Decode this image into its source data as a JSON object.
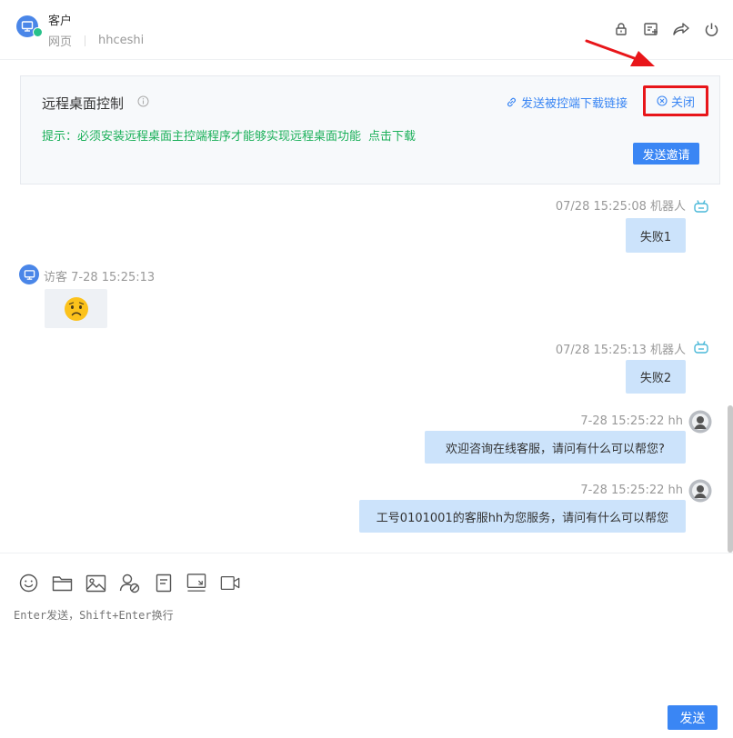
{
  "header": {
    "title": "客户",
    "channel": "网页",
    "account": "hhceshi",
    "icons": [
      "lock-icon",
      "note-add-icon",
      "share-icon",
      "power-icon"
    ]
  },
  "remote": {
    "title": "远程桌面控制",
    "send_link": "发送被控端下载链接",
    "close": "关闭",
    "tip": "提示：必须安装远程桌面主控端程序才能够实现远程桌面功能",
    "download": "点击下载",
    "invite": "发送邀请"
  },
  "messages": [
    {
      "side": "right",
      "meta": "07/28 15:25:08 机器人",
      "text": "失败1",
      "avatar": "robot-icon"
    },
    {
      "side": "left",
      "meta": "访客 7-28 15:25:13",
      "text": "😟",
      "avatar": "monitor-icon"
    },
    {
      "side": "right",
      "meta": "07/28 15:25:13 机器人",
      "text": "失败2",
      "avatar": "robot-icon"
    },
    {
      "side": "right",
      "meta": "7-28 15:25:22 hh",
      "text": "欢迎咨询在线客服，请问有什么可以帮您?",
      "avatar": "agent-avatar"
    },
    {
      "side": "right",
      "meta": "7-28 15:25:22 hh",
      "text": "工号0101001的客服hh为您服务，请问有什么可以帮您",
      "avatar": "agent-avatar"
    }
  ],
  "toolbar": {
    "tools": [
      "emoji-icon",
      "folder-icon",
      "image-icon",
      "transfer-user-icon",
      "document-icon",
      "screen-capture-icon",
      "video-icon"
    ]
  },
  "input": {
    "placeholder": "Enter发送，Shift+Enter换行",
    "send": "发送"
  },
  "colors": {
    "accent": "#3a86f4",
    "bubble_right": "#cce3fb",
    "bubble_left": "#eef1f5",
    "tip_green": "#1bb05a",
    "highlight_red": "#e8161a"
  }
}
